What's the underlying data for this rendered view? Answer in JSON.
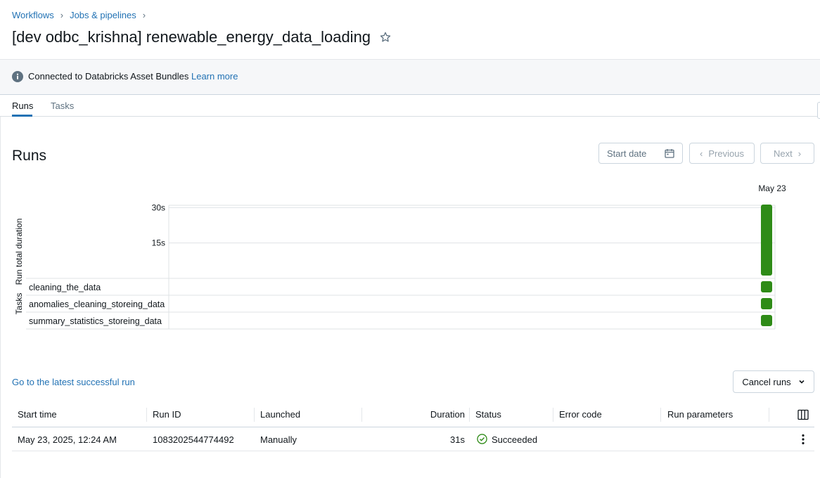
{
  "breadcrumb": [
    "Workflows",
    "Jobs & pipelines"
  ],
  "title": "[dev odbc_krishna] renewable_energy_data_loading",
  "banner": {
    "text": "Connected to Databricks Asset Bundles",
    "link": "Learn more"
  },
  "tabs": [
    {
      "label": "Runs",
      "active": true
    },
    {
      "label": "Tasks",
      "active": false
    }
  ],
  "runs_section": {
    "heading": "Runs",
    "start_date_placeholder": "Start date",
    "previous_label": "Previous",
    "next_label": "Next"
  },
  "chart_data": {
    "type": "bar",
    "ylabel": "Run total duration",
    "tasks_label": "Tasks",
    "y_ticks": [
      "30s",
      "15s"
    ],
    "ylim": [
      0,
      31
    ],
    "categories": [
      "May 23"
    ],
    "series": [
      {
        "values": [
          31
        ]
      }
    ],
    "tasks": [
      "cleaning_the_data",
      "anomalies_cleaning_storeing_data",
      "summary_statistics_storeing_data"
    ],
    "task_status": [
      "Succeeded",
      "Succeeded",
      "Succeeded"
    ],
    "colors": {
      "success": "#2e8b17",
      "grid": "#dfe3e6"
    }
  },
  "latest_link": "Go to the latest successful run",
  "cancel_runs_label": "Cancel runs",
  "table": {
    "columns": [
      "Start time",
      "Run ID",
      "Launched",
      "Duration",
      "Status",
      "Error code",
      "Run parameters"
    ],
    "rows": [
      {
        "start_time": "May 23, 2025, 12:24 AM",
        "run_id": "1083202544774492",
        "launched": "Manually",
        "duration": "31s",
        "status": "Succeeded",
        "error_code": "",
        "run_parameters": ""
      }
    ]
  },
  "colors": {
    "accent": "#2272b4",
    "success": "#2e8b17"
  }
}
